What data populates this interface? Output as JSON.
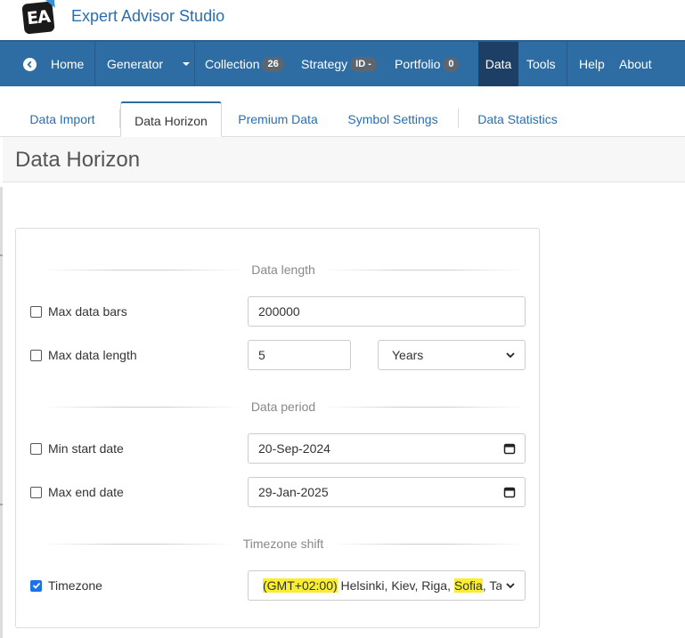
{
  "app": {
    "logo_text": "EA",
    "title": "Expert Advisor Studio"
  },
  "nav": {
    "home": "Home",
    "generator": "Generator",
    "collection": "Collection",
    "collection_badge": "26",
    "strategy": "Strategy",
    "strategy_badge": "ID -",
    "portfolio": "Portfolio",
    "portfolio_badge": "0",
    "data": "Data",
    "tools": "Tools",
    "help": "Help",
    "about": "About"
  },
  "tabs": [
    "Data Import",
    "Data Horizon",
    "Premium Data",
    "Symbol Settings",
    "Data Statistics"
  ],
  "page_title": "Data Horizon",
  "sections": {
    "data_length": "Data length",
    "data_period": "Data period",
    "timezone_shift": "Timezone shift"
  },
  "fields": {
    "max_data_bars": {
      "label": "Max data bars",
      "checked": false,
      "value": "200000"
    },
    "max_data_length": {
      "label": "Max data length",
      "checked": false,
      "value": "5",
      "unit": "Years"
    },
    "min_start_date": {
      "label": "Min start date",
      "checked": false,
      "value": "20-Sep-2024"
    },
    "max_end_date": {
      "label": "Max end date",
      "checked": false,
      "value": "29-Jan-2025"
    },
    "timezone": {
      "label": "Timezone",
      "checked": true,
      "value_offset": "(GMT+02:00)",
      "value_cities_a": " Helsinki, Kiev, Riga, ",
      "value_city_hl": "Sofia",
      "value_cities_b": ", Tallinn, Vilnius"
    }
  },
  "colors": {
    "nav_bg": "#2e6da4",
    "nav_active": "#1d3f66",
    "link": "#2a6eb0",
    "highlight": "#fbee2c",
    "checkbox_checked": "#1a73e8"
  },
  "icons": [
    "home-icon",
    "caret-down-icon",
    "calendar-icon",
    "chevron-down-icon",
    "checkmark-icon"
  ]
}
